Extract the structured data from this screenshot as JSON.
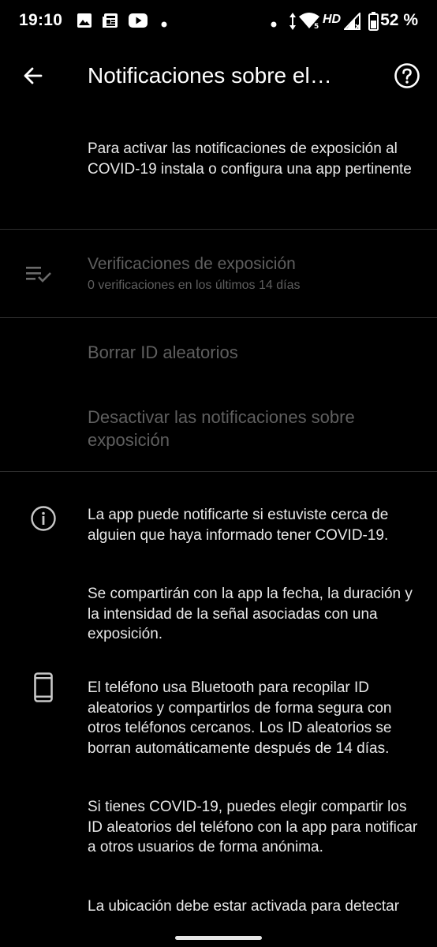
{
  "status_bar": {
    "time": "19:10",
    "hd": "HD",
    "battery": "52 %",
    "icons": [
      "image-icon",
      "news-icon",
      "youtube-icon",
      "dot-icon",
      "dot-icon",
      "data-arrows-icon",
      "wifi-icon",
      "signal-icon",
      "battery-icon"
    ]
  },
  "app_bar": {
    "title": "Notificaciones sobre el…",
    "back_icon": "arrow-back-icon",
    "help_icon": "help-circle-icon"
  },
  "intro": {
    "text": "Para activar las notificaciones de exposición al COVID-19 instala o configura una app pertinente"
  },
  "checks": {
    "icon": "checklist-icon",
    "title": "Verificaciones de exposición",
    "subtitle": "0 verificaciones en los últimos 14 días"
  },
  "actions": {
    "delete_ids": "Borrar ID aleatorios",
    "deactivate": "Desactivar las notificaciones sobre exposición"
  },
  "info": {
    "icon": "info-icon",
    "p1": "La app puede notificarte si estuviste cerca de alguien que haya informado tener COVID-19.",
    "p2": "Se compartirán con la app la fecha, la duración y la intensidad de la señal asociadas con una exposición."
  },
  "phone": {
    "icon": "phone-icon",
    "p1": "El teléfono usa Bluetooth para recopilar ID aleatorios y compartirlos de forma segura con otros teléfonos cercanos. Los ID aleatorios se borran automáticamente después de 14 días.",
    "p2": "Si tienes COVID-19, puedes elegir compartir los ID aleatorios del teléfono con la app para notificar a otros usuarios de forma anónima.",
    "p3": "La ubicación debe estar activada para detectar dispositivos Bluetooth cercanos"
  },
  "colors": {
    "background": "#000000",
    "text": "#e8e8e8",
    "disabled": "#5f5f5f",
    "divider": "#2e2e2e"
  }
}
